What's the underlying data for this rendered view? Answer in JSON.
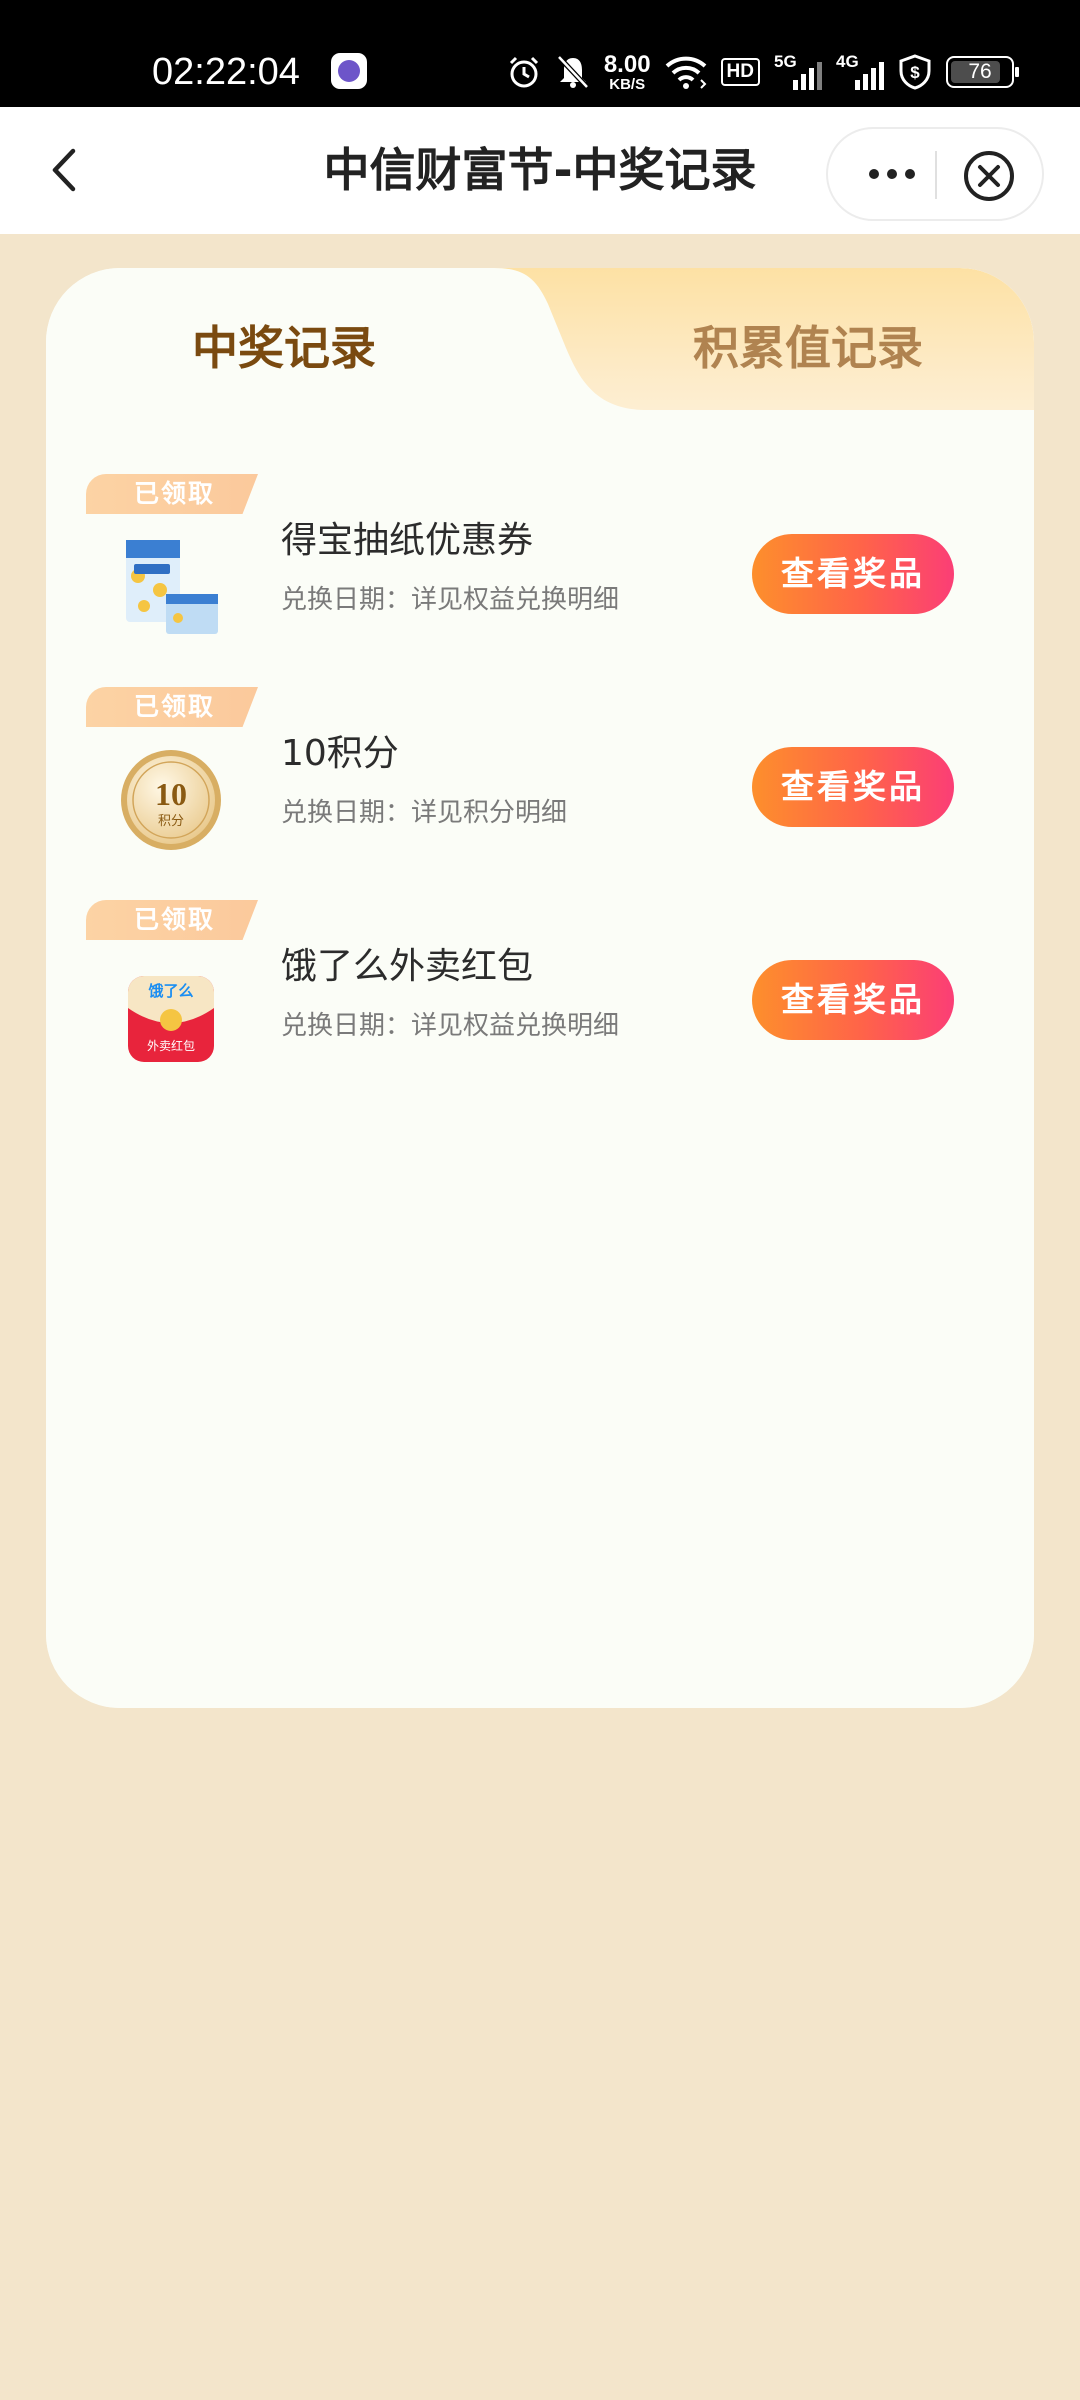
{
  "status_bar": {
    "time": "02:22:04",
    "speed_value": "8.00",
    "speed_unit": "KB/S",
    "hd_label": "HD",
    "net1_label": "5G",
    "net2_label": "4G",
    "battery": "76",
    "icons": [
      "app-icon",
      "alarm-icon",
      "mute-icon",
      "wifi-icon",
      "hd-icon",
      "signal-5g-icon",
      "signal-4g-icon",
      "shield-dollar-icon",
      "battery-icon"
    ]
  },
  "nav": {
    "title": "中信财富节-中奖记录",
    "icons": [
      "back-icon",
      "more-icon",
      "close-icon"
    ]
  },
  "tabs": [
    {
      "label": "中奖记录",
      "active": true
    },
    {
      "label": "积累值记录",
      "active": false
    }
  ],
  "records": [
    {
      "badge": "已领取",
      "title": "得宝抽纸优惠券",
      "date": "兑换日期：详见权益兑换明细",
      "button": "查看奖品",
      "thumb": "tissue-pack-icon"
    },
    {
      "badge": "已领取",
      "title": "10积分",
      "date": "兑换日期：详见积分明细",
      "button": "查看奖品",
      "thumb": "points-coin-icon",
      "coin_value": "10",
      "coin_unit": "积分"
    },
    {
      "badge": "已领取",
      "title": "饿了么外卖红包",
      "date": "兑换日期：详见权益兑换明细",
      "button": "查看奖品",
      "thumb": "eleme-red-packet-icon",
      "packet_brand": "饿了么",
      "packet_label": "外卖红包"
    }
  ],
  "colors": {
    "page_bg": "#f3e5cb",
    "card_bg": "#fbfdf7",
    "tab_active_text": "#7a4a10",
    "tab_inactive_text": "#b08350",
    "button_gradient_start": "#fd8f2c",
    "button_gradient_end": "#fb3e76",
    "badge_bg": "#fcd3a4"
  }
}
